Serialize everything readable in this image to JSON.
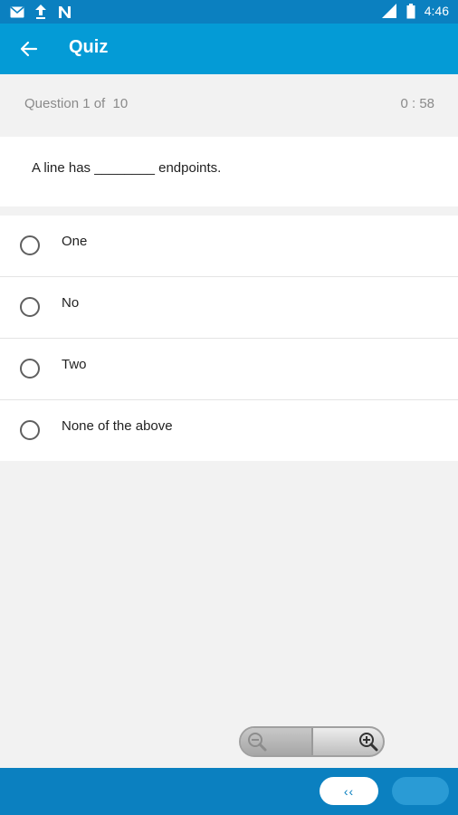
{
  "status_bar": {
    "left_icons": [
      "gmail-icon",
      "upload-icon",
      "n-app-icon"
    ],
    "right_icons": [
      "signal-icon",
      "battery-icon"
    ],
    "time": "4:46"
  },
  "app_bar": {
    "title": "Quiz",
    "back_icon": "arrow-left-icon"
  },
  "quiz": {
    "counter": "Question 1 of  10",
    "timer": "0 : 58",
    "question": "A line has ________ endpoints.",
    "options": [
      "One",
      "No",
      "Two",
      "None of the above"
    ]
  },
  "zoom": {
    "out_icon": "zoom-out-icon",
    "in_icon": "zoom-in-icon"
  },
  "nav": {
    "prev_label": "‹‹"
  },
  "colors": {
    "status_bar": "#0b80c0",
    "app_bar": "#049bd6",
    "background": "#f2f2f2",
    "next_button": "#2a9bd5"
  }
}
